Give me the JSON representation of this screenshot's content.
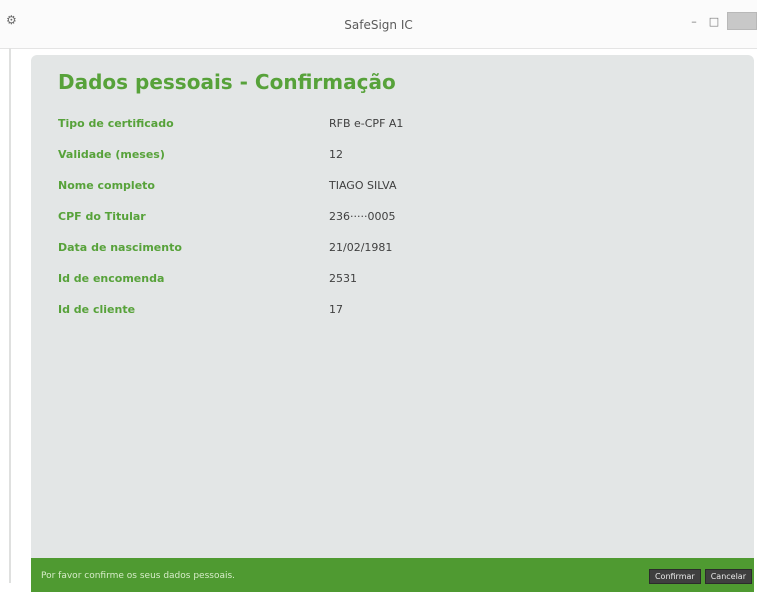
{
  "window": {
    "title": "SafeSign IC",
    "icon": "gear-icon",
    "controls": {
      "minimize": "–",
      "maximize": "□"
    }
  },
  "page": {
    "title": "Dados pessoais  -  Confirmação"
  },
  "fields": [
    {
      "label": "Tipo de certificado",
      "value": "RFB e-CPF A1"
    },
    {
      "label": "Validade (meses)",
      "value": "12"
    },
    {
      "label": "Nome completo",
      "value": "TIAGO SILVA"
    },
    {
      "label": "CPF do Titular",
      "value": "236·····0005"
    },
    {
      "label": "Data de nascimento",
      "value": "21/02/1981"
    },
    {
      "label": "Id de encomenda",
      "value": "2531"
    },
    {
      "label": "Id de cliente",
      "value": "17"
    }
  ],
  "statusbar": {
    "message": "Por favor confirme os seus dados pessoais.",
    "confirm_label": "Confirmar",
    "cancel_label": "Cancelar"
  },
  "colors": {
    "accent": "#57a23a",
    "statusbar": "#4f9a31",
    "panel": "#e3e6e6"
  }
}
